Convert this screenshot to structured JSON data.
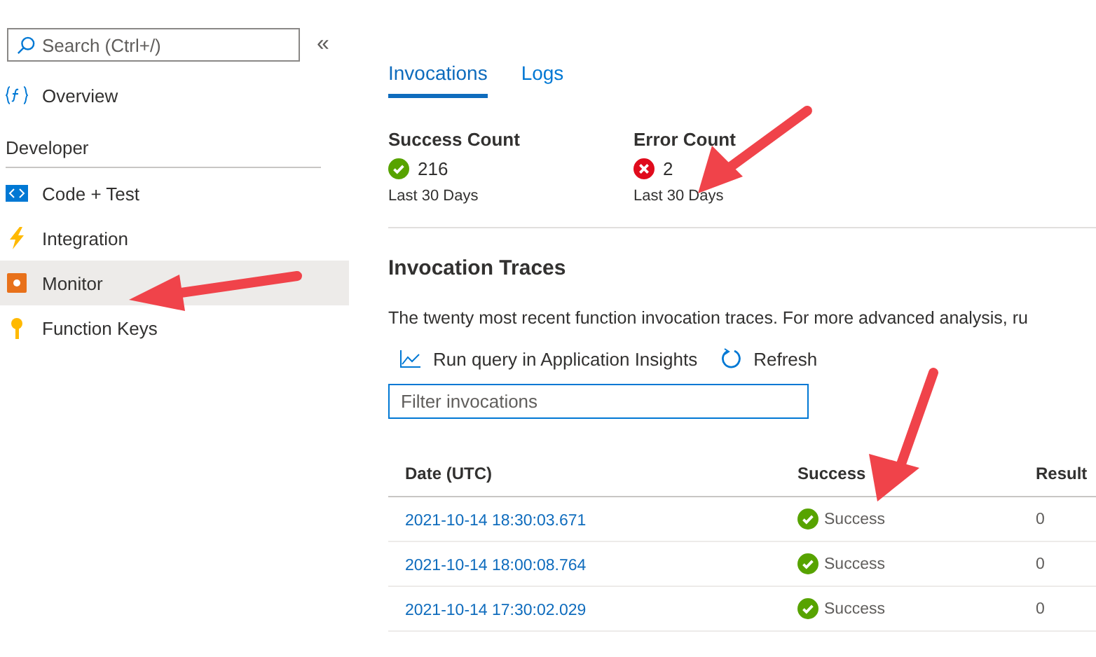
{
  "sidebar": {
    "search": {
      "placeholder": "Search (Ctrl+/)"
    },
    "collapse": "«",
    "items": [
      {
        "label": "Overview",
        "kind": "function",
        "selected": false
      }
    ],
    "sections": [
      {
        "title": "Developer",
        "items": [
          {
            "label": "Code + Test",
            "kind": "code",
            "selected": false
          },
          {
            "label": "Integration",
            "kind": "bolt",
            "selected": false
          },
          {
            "label": "Monitor",
            "kind": "monitor",
            "selected": true
          },
          {
            "label": "Function Keys",
            "kind": "key",
            "selected": false
          }
        ]
      }
    ]
  },
  "tabs": [
    {
      "label": "Invocations",
      "selected": true
    },
    {
      "label": "Logs",
      "selected": false
    }
  ],
  "stats": [
    {
      "title": "Success Count",
      "kind": "success",
      "value": "216",
      "period": "Last 30 Days"
    },
    {
      "title": "Error Count",
      "kind": "error",
      "value": "2",
      "period": "Last 30 Days"
    }
  ],
  "traces": {
    "title": "Invocation Traces",
    "description": "The twenty most recent function invocation traces. For more advanced analysis, ru",
    "toolbar": [
      {
        "label": "Run query in Application Insights",
        "kind": "chart"
      },
      {
        "label": "Refresh",
        "kind": "refresh"
      }
    ],
    "filter": {
      "placeholder": "Filter invocations"
    },
    "columns": [
      "Date (UTC)",
      "Success",
      "Result"
    ],
    "rows": [
      {
        "date": "2021-10-14 18:30:03.671",
        "status": "Success",
        "kind": "success",
        "result": "0"
      },
      {
        "date": "2021-10-14 18:00:08.764",
        "status": "Success",
        "kind": "success",
        "result": "0"
      },
      {
        "date": "2021-10-14 17:30:02.029",
        "status": "Success",
        "kind": "success",
        "result": "0"
      }
    ]
  }
}
